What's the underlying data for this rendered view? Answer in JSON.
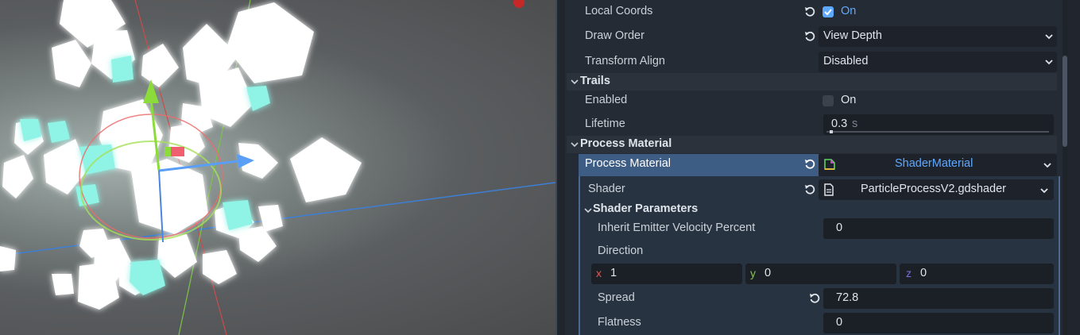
{
  "inspector": {
    "local_coords": {
      "label": "Local Coords",
      "value": "On",
      "checked": true
    },
    "draw_order": {
      "label": "Draw Order",
      "value": "View Depth"
    },
    "transform_align": {
      "label": "Transform Align",
      "value": "Disabled"
    },
    "trails_section": "Trails",
    "trails_enabled": {
      "label": "Enabled",
      "value": "On",
      "checked": false
    },
    "lifetime": {
      "label": "Lifetime",
      "value": "0.3",
      "unit": "s",
      "slider_fraction": 0.03
    },
    "process_material_section": "Process Material",
    "process_material": {
      "label": "Process Material",
      "value": "ShaderMaterial"
    },
    "shader": {
      "label": "Shader",
      "value": "ParticleProcessV2.gdshader"
    },
    "shader_params_section": "Shader Parameters",
    "inherit_velocity": {
      "label": "Inherit Emitter Velocity Percent",
      "value": "0"
    },
    "direction": {
      "label": "Direction",
      "x_label": "x",
      "x": "1",
      "y_label": "y",
      "y": "0",
      "z_label": "z",
      "z": "0"
    },
    "spread": {
      "label": "Spread",
      "value": "72.8"
    },
    "flatness": {
      "label": "Flatness",
      "value": "0"
    }
  },
  "colors": {
    "accent": "#5fa8ff",
    "selected_row": "#3d5d85",
    "x_axis": "#e05a5a",
    "y_axis": "#8bc34a",
    "z_axis": "#7a6fe0"
  }
}
